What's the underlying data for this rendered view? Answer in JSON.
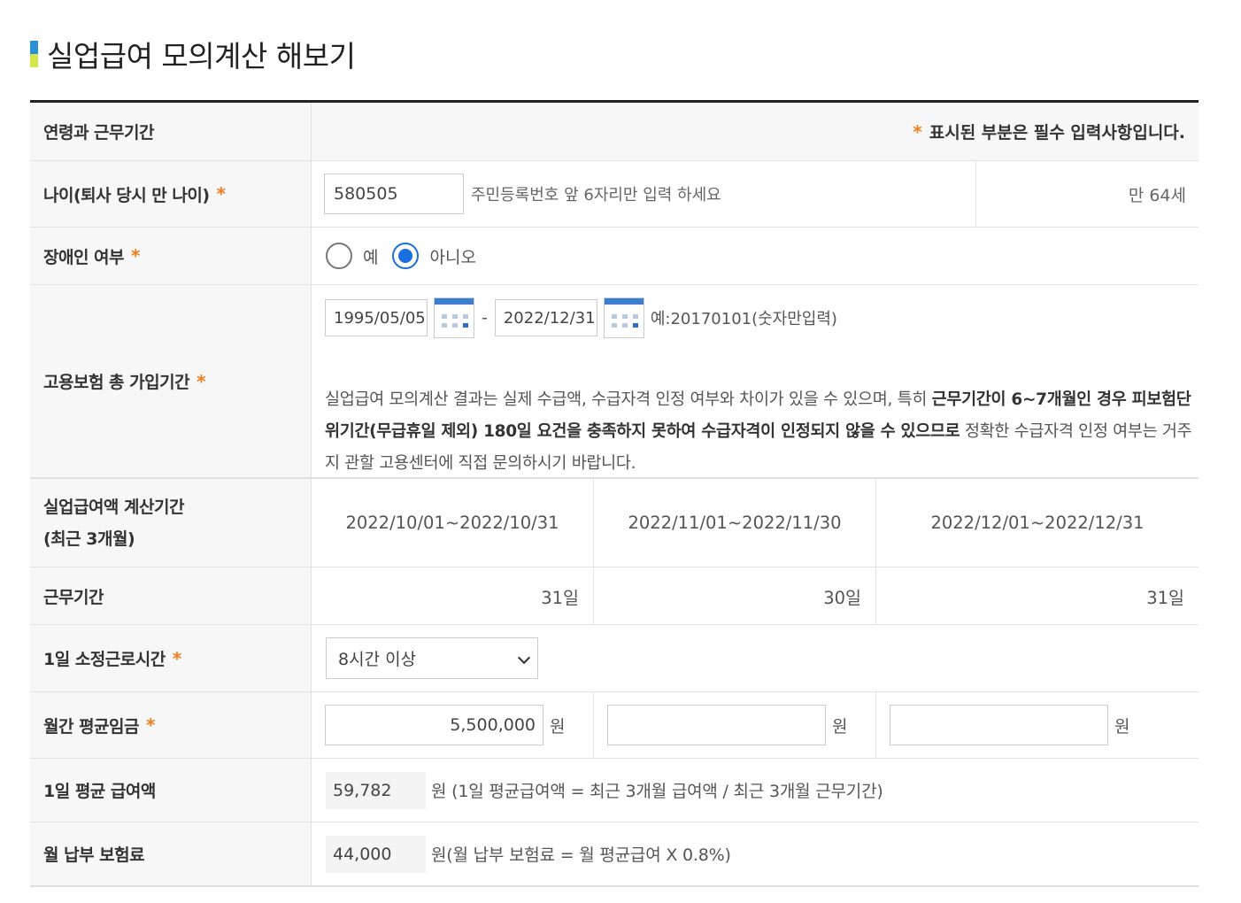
{
  "page": {
    "title": "실업급여 모의계산 해보기"
  },
  "colors": {
    "accent_blue": "#2b8fd6",
    "accent_green": "#d5e64a",
    "required": "#f07d1a",
    "radio_on": "#1a6fe0"
  },
  "header_row": {
    "label": "연령과 근무기간",
    "required_note": "표시된 부분은 필수 입력사항입니다."
  },
  "age": {
    "label": "나이(퇴사 당시 만 나이)",
    "value": "580505",
    "hint": "주민등록번호 앞 6자리만 입력 하세요",
    "result": "만 64세"
  },
  "disabled": {
    "label": "장애인 여부",
    "options": [
      {
        "label": "예",
        "selected": false
      },
      {
        "label": "아니오",
        "selected": true
      }
    ]
  },
  "insurance": {
    "label": "고용보험 총 가입기간",
    "start": "1995/05/05",
    "end": "2022/12/31",
    "dash": "-",
    "example": "예:20170101(숫자만입력)",
    "calendar_icon": "calendar-icon",
    "notice_pre": "실업급여 모의계산 결과는 실제 수급액, 수급자격 인정 여부와 차이가 있을 수 있으며, 특히 ",
    "notice_bold": "근무기간이 6~7개월인 경우 피보험단위기간(무급휴일 제외) 180일 요건을 충족하지 못하여 수급자격이 인정되지 않을 수 있으므로",
    "notice_post": " 정확한 수급자격 인정 여부는 거주지 관할 고용센터에 직접 문의하시기 바랍니다."
  },
  "period": {
    "label_line1": "실업급여액 계산기간",
    "label_line2": "(최근 3개월)",
    "months": [
      "2022/10/01~2022/10/31",
      "2022/11/01~2022/11/30",
      "2022/12/01~2022/12/31"
    ]
  },
  "work_days": {
    "label": "근무기간",
    "values": [
      "31일",
      "30일",
      "31일"
    ]
  },
  "hours": {
    "label": "1일 소정근로시간",
    "selected": "8시간 이상"
  },
  "wage": {
    "label": "월간 평균임금",
    "values": [
      "5,500,000",
      "",
      ""
    ],
    "unit": "원"
  },
  "daily_benefit": {
    "label": "1일 평균 급여액",
    "value": "59,782",
    "formula": "원 (1일 평균급여액 = 최근 3개월 급여액 / 최근 3개월 근무기간)"
  },
  "monthly_premium": {
    "label": "월 납부 보험료",
    "value": "44,000",
    "formula": "원(월 납부 보험료 = 월 평균급여 X 0.8%)"
  },
  "required_mark": "*"
}
